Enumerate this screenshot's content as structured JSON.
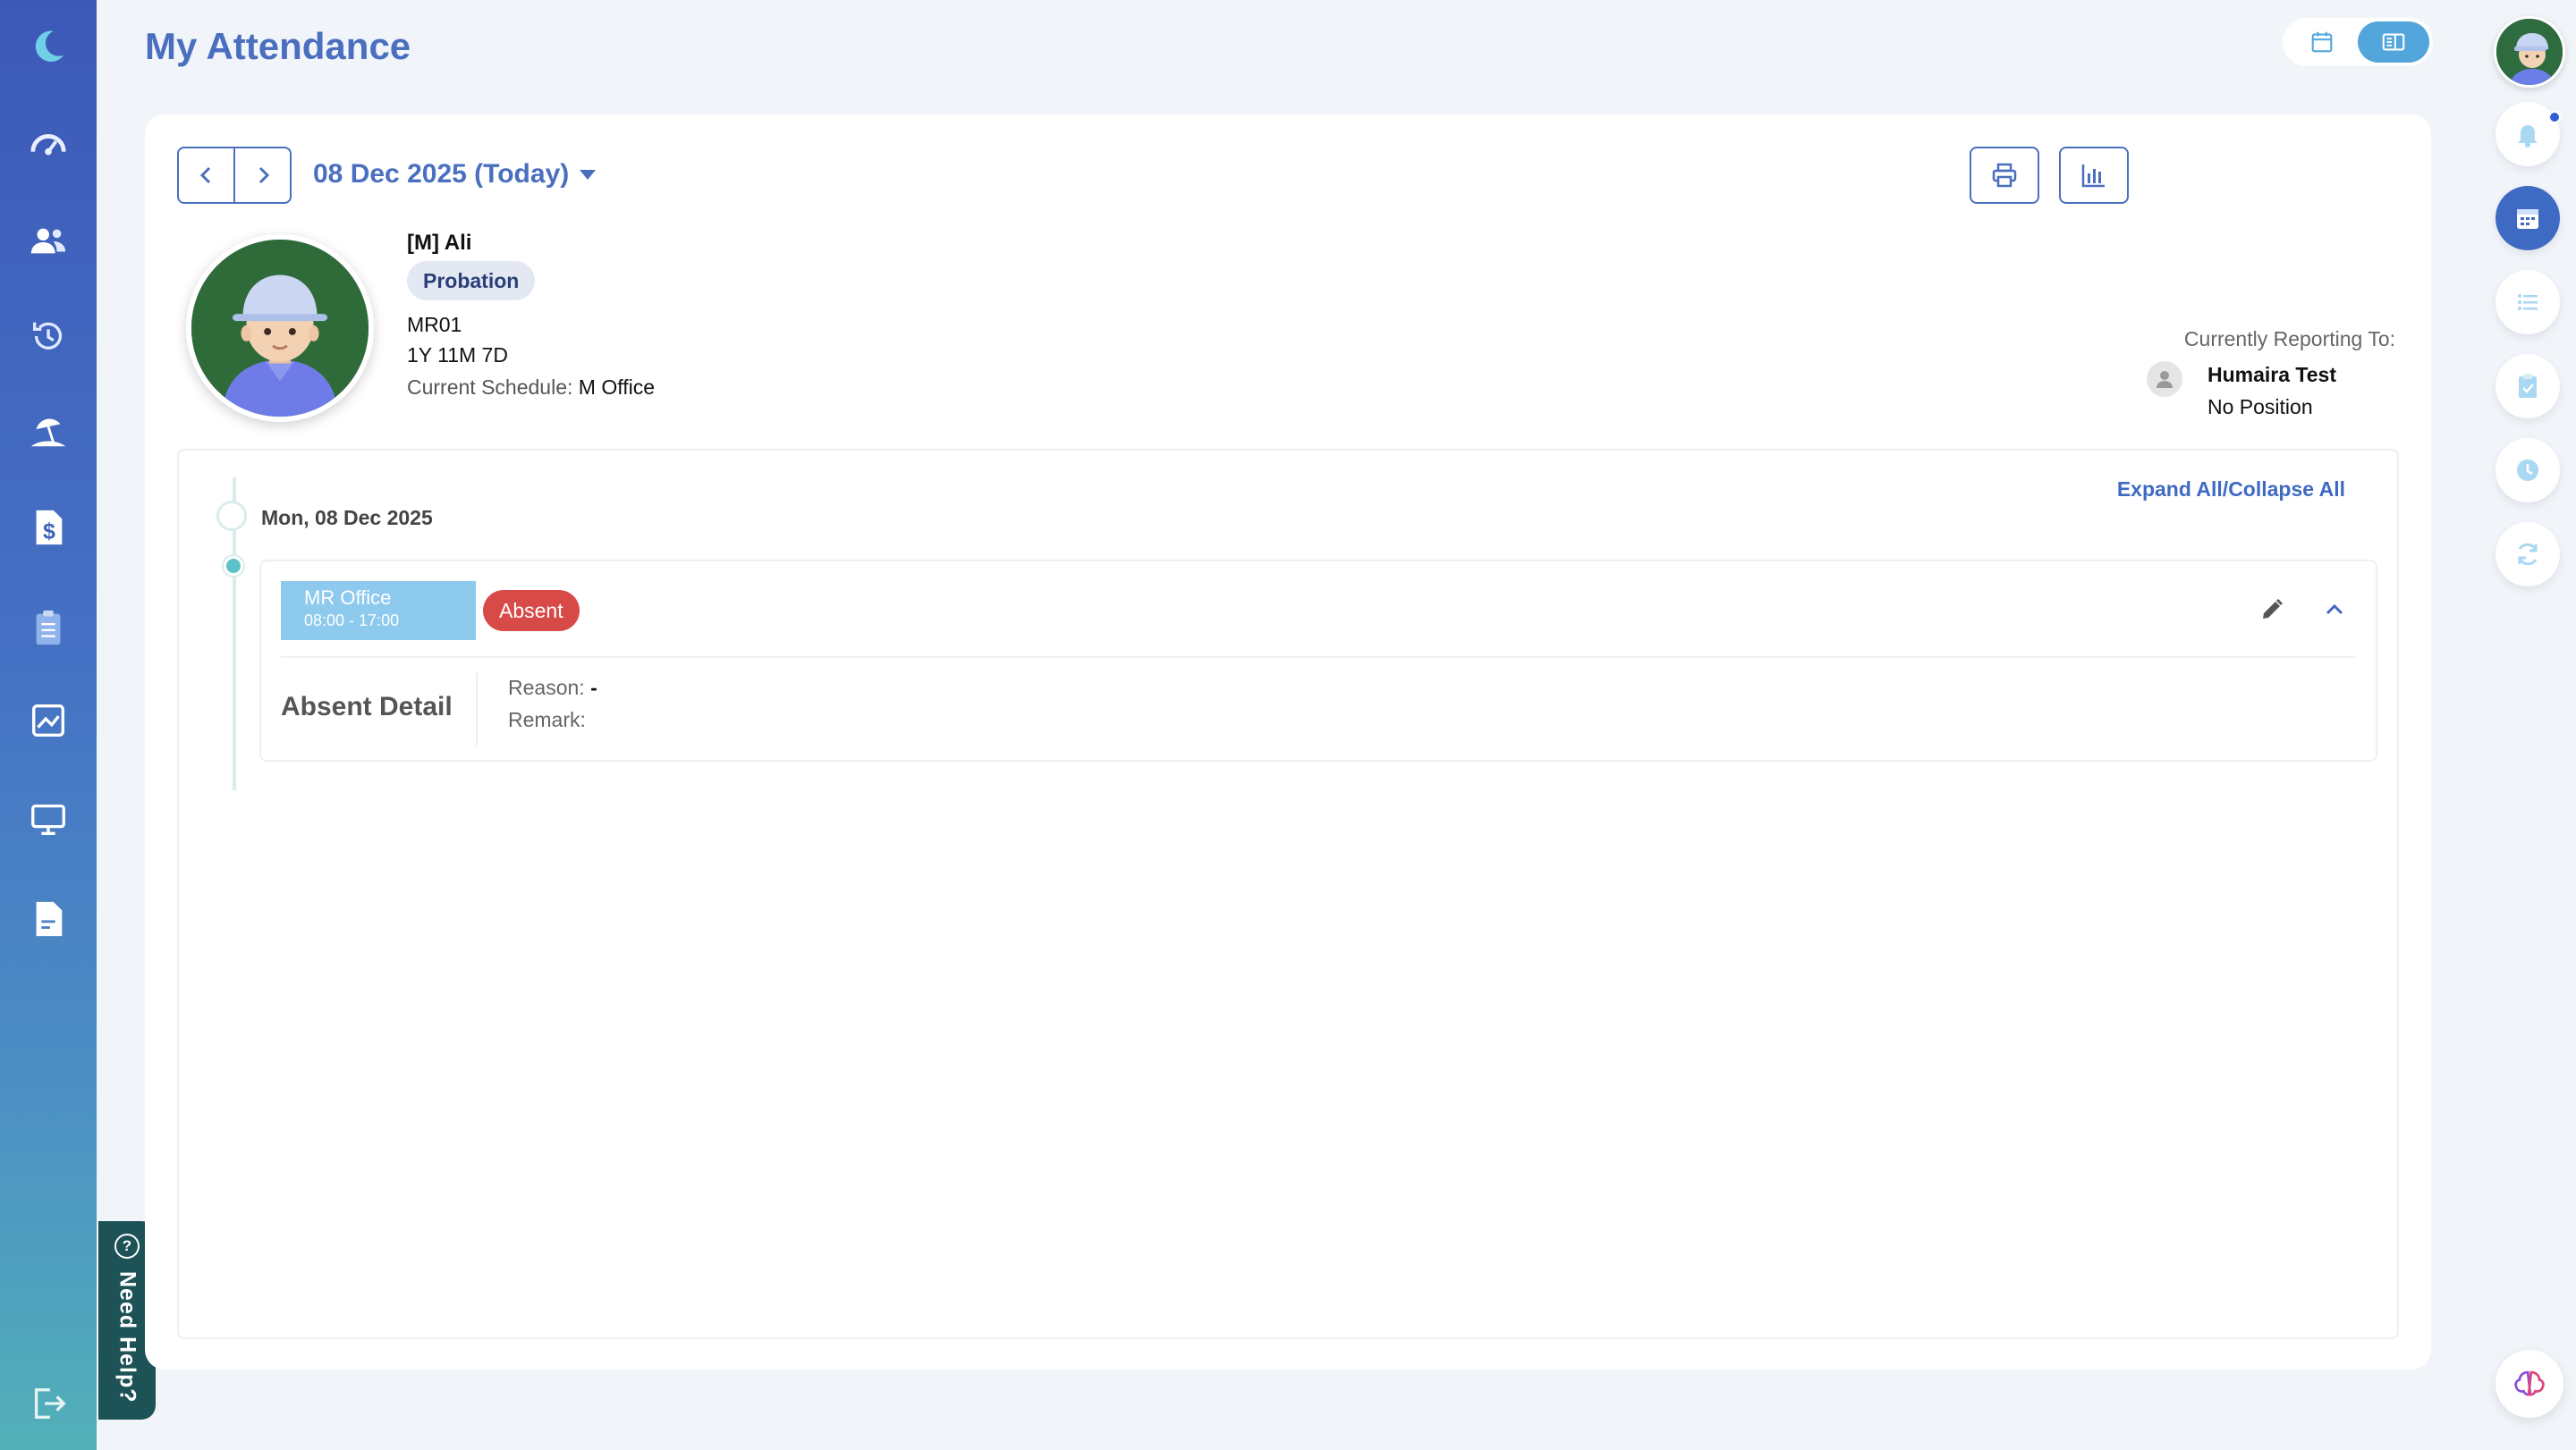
{
  "header": {
    "title": "My Attendance"
  },
  "toolbar": {
    "date_label": "08 Dec 2025 (Today)"
  },
  "employee": {
    "name": "[M] Ali",
    "status_badge": "Probation",
    "code": "MR01",
    "tenure": "1Y 11M 7D",
    "schedule_label": "Current Schedule:",
    "schedule_value": "M Office"
  },
  "reporting": {
    "title": "Currently Reporting To:",
    "name": "Humaira Test",
    "position": "No Position"
  },
  "timeline": {
    "expand_label": "Expand All/Collapse All",
    "day_label": "Mon, 08 Dec 2025",
    "entry": {
      "schedule_name": "MR Office",
      "schedule_time": "08:00 - 17:00",
      "status": "Absent",
      "detail_title": "Absent Detail",
      "reason_label": "Reason:",
      "reason_value": "-",
      "remark_label": "Remark:",
      "remark_value": ""
    }
  },
  "help": {
    "label": "Need Help?",
    "icon_glyph": "?"
  },
  "sidebar_icons": [
    "moon-logo-icon",
    "dashboard-gauge-icon",
    "people-icon",
    "history-clock-icon",
    "leave-beach-icon",
    "payroll-dollar-icon",
    "clipboard-icon",
    "chart-image-icon",
    "monitor-icon",
    "document-icon",
    "logout-icon"
  ],
  "rail_icons": [
    "bell-icon",
    "calendar-icon",
    "list-icon",
    "clipboard-check-icon",
    "clock-icon",
    "refresh-icon"
  ],
  "colors": {
    "accent": "#4a6fbf",
    "absent": "#d74a47",
    "schedule_chip": "#8ec9ee",
    "timeline_dot": "#5cc3c8",
    "help_tab": "#1d5256"
  }
}
